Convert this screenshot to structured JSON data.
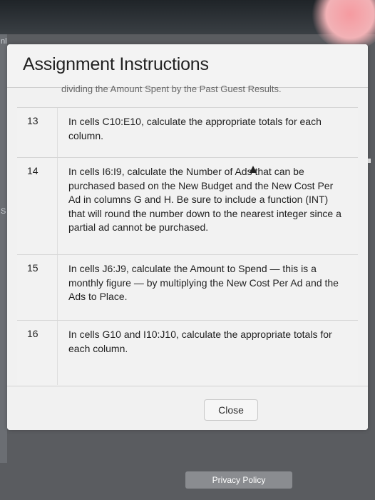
{
  "modal": {
    "title": "Assignment Instructions",
    "truncated_text": "dividing the Amount Spent by the Past Guest Results.",
    "steps": [
      {
        "number": "13",
        "text": "In cells C10:E10, calculate the appropriate totals for each column."
      },
      {
        "number": "14",
        "text": "In cells I6:I9, calculate the Number of Ads that can be purchased based on the New Budget and the New Cost Per Ad in columns G and H. Be sure to include a function (INT) that will round the number down to the nearest integer since a partial ad cannot be purchased."
      },
      {
        "number": "15",
        "text": "In cells J6:J9, calculate the Amount to Spend — this is a monthly figure — by multiplying the New Cost Per Ad and the Ads to Place."
      },
      {
        "number": "16",
        "text": "In cells G10 and I10:J10, calculate the appropriate totals for each column."
      }
    ],
    "close_label": "Close"
  },
  "footer": {
    "privacy_label": "Privacy Policy"
  },
  "edge": {
    "top_left": "nl",
    "left_mid": "S"
  },
  "colors": {
    "background": "#5a5c60",
    "modal": "#f1f1f1",
    "privacy_bg": "#8a8c90"
  }
}
